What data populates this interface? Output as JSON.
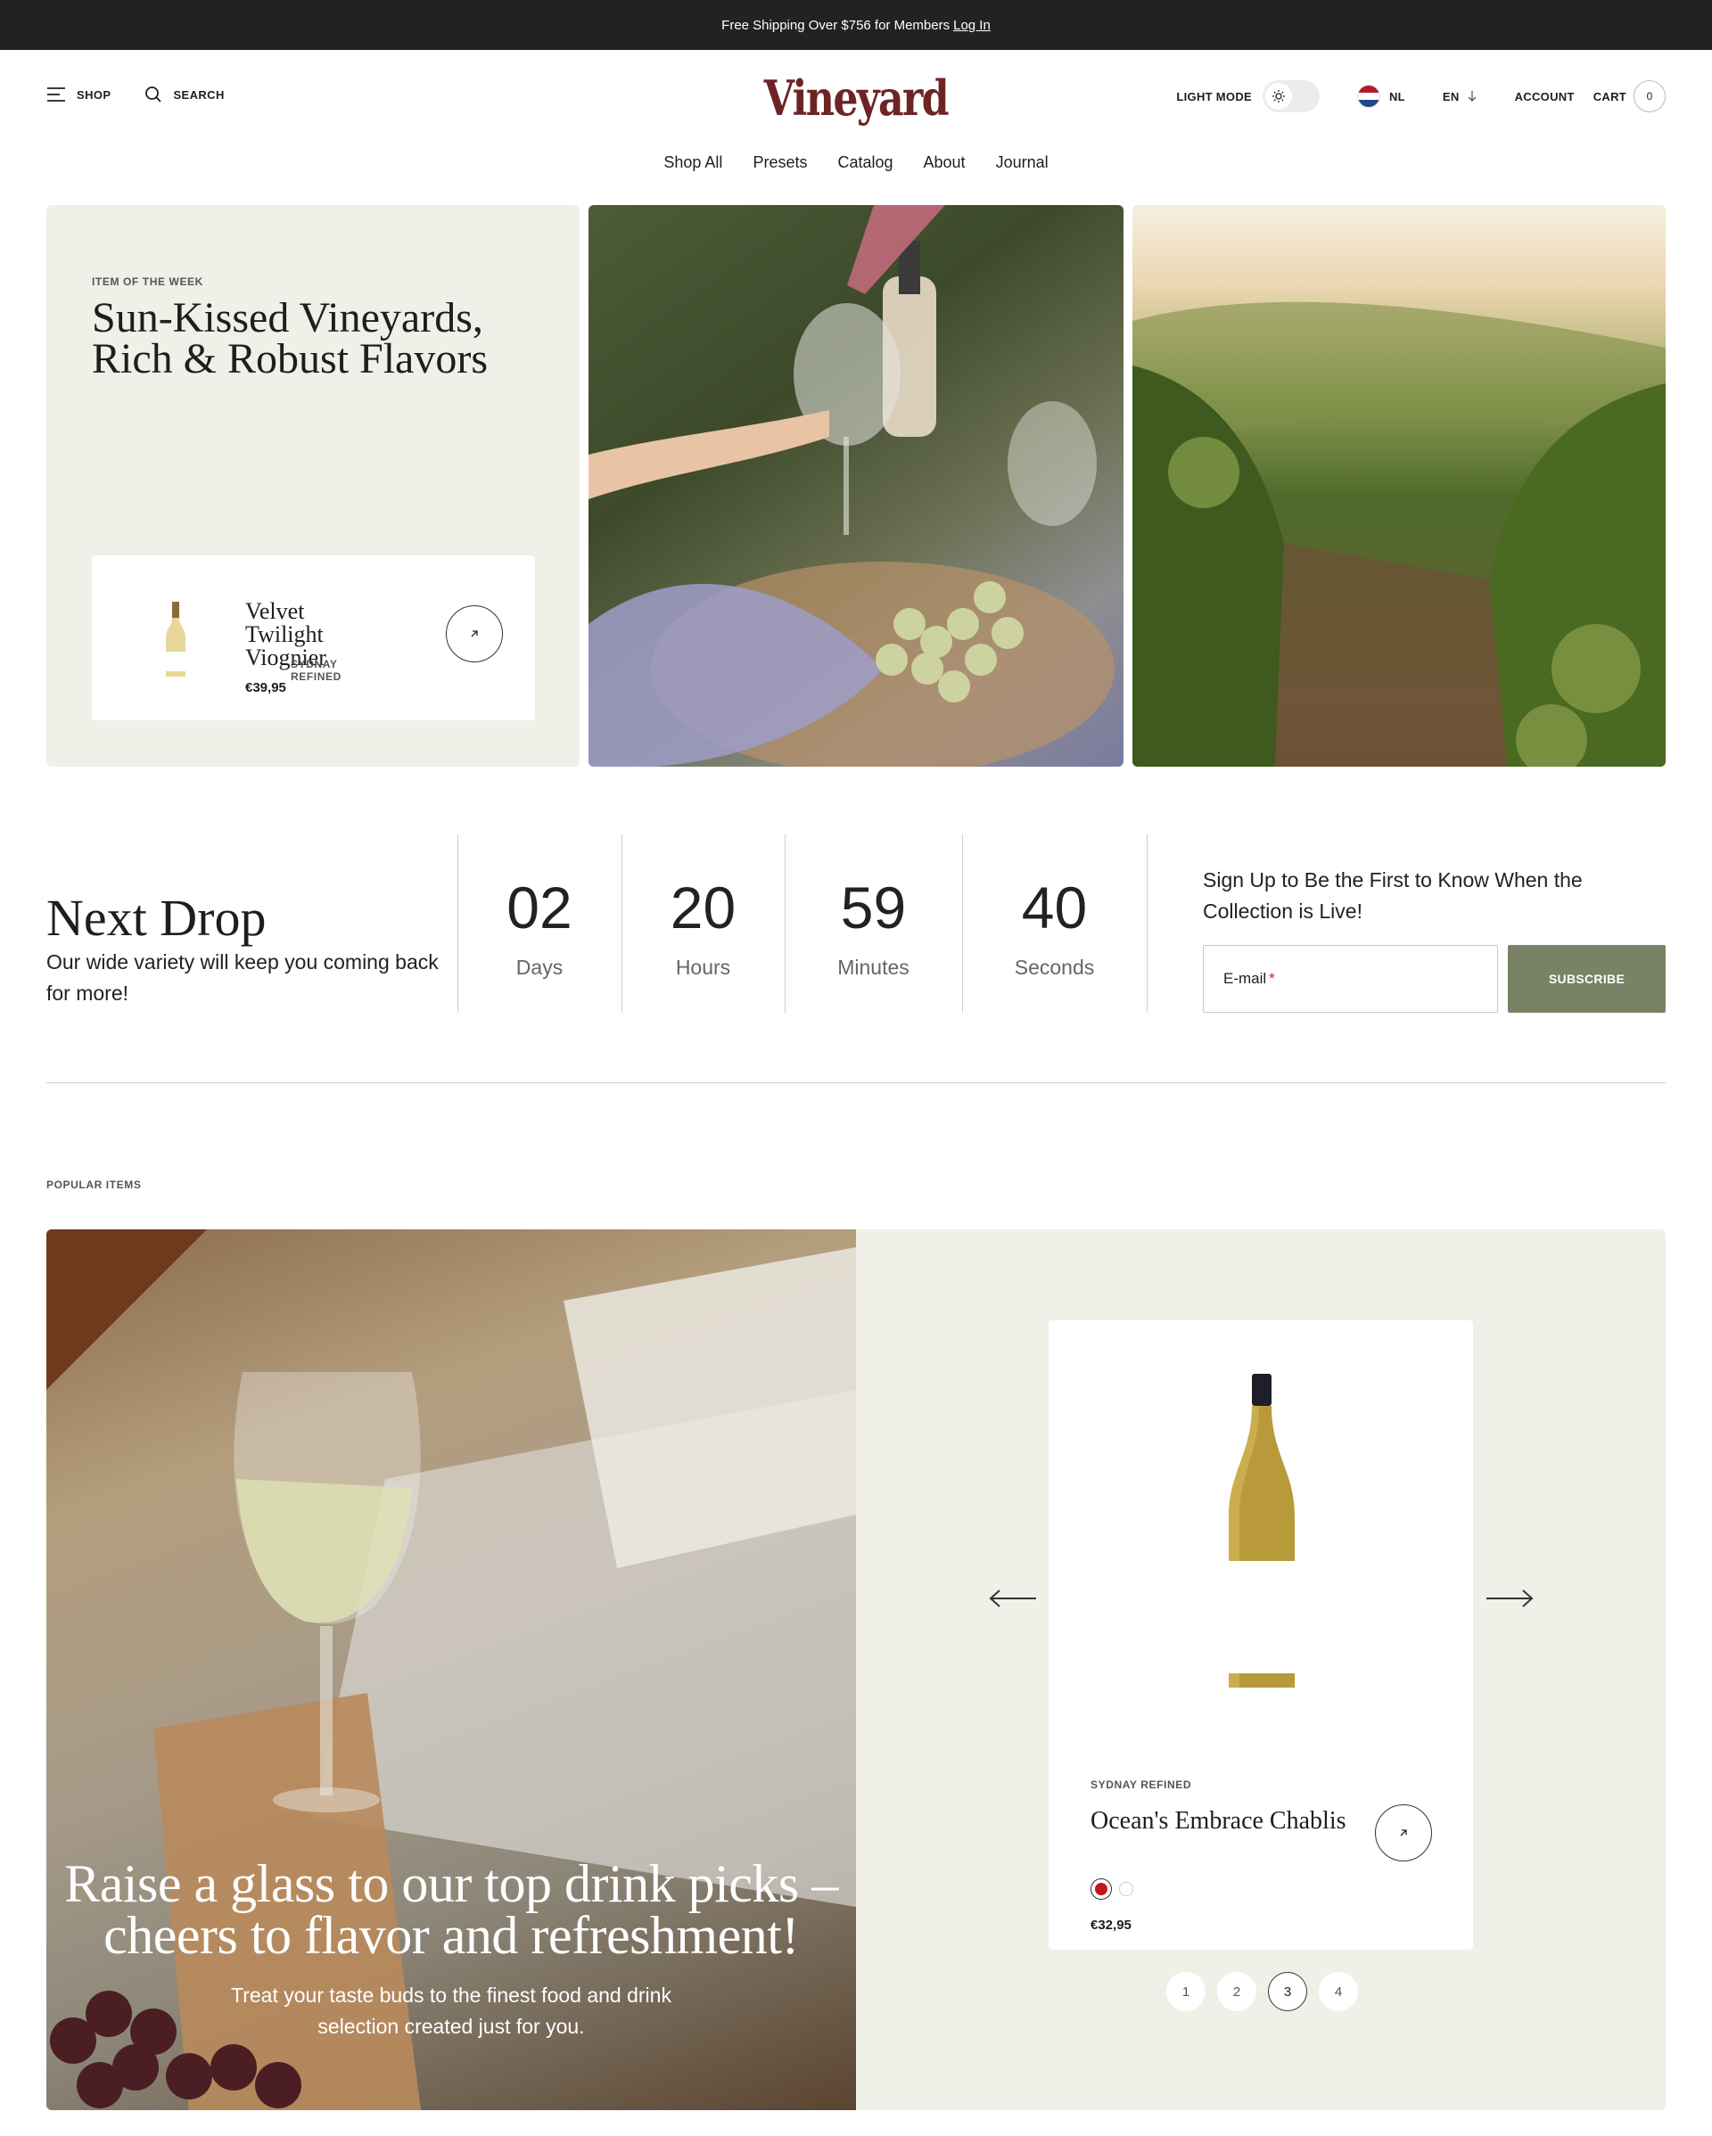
{
  "announcement": {
    "text": "Free Shipping Over $756 for Members",
    "link": "Log In"
  },
  "header": {
    "shop": "SHOP",
    "search": "SEARCH",
    "logo": "Vineyard",
    "light_mode": "LIGHT MODE",
    "country": "NL",
    "language": "EN",
    "account": "ACCOUNT",
    "cart": "CART",
    "cart_count": "0"
  },
  "nav": [
    "Shop All",
    "Presets",
    "Catalog",
    "About",
    "Journal"
  ],
  "hero": {
    "eyebrow": "ITEM OF THE WEEK",
    "title": "Sun-Kissed Vineyards, Rich & Robust Flavors",
    "product": {
      "vendor": "SYDNAY REFINED",
      "name": "Velvet Twilight Viognier",
      "price": "€39,95"
    }
  },
  "countdown": {
    "title": "Next Drop",
    "subtitle": "Our wide variety will keep you coming back for more!",
    "units": [
      {
        "value": "02",
        "label": "Days"
      },
      {
        "value": "20",
        "label": "Hours"
      },
      {
        "value": "59",
        "label": "Minutes"
      },
      {
        "value": "40",
        "label": "Seconds"
      }
    ],
    "signup_text": "Sign Up to Be the First to Know When the Collection is Live!",
    "email_label": "E-mail",
    "email_required": "*",
    "subscribe": "SUBSCRIBE"
  },
  "popular": {
    "eyebrow": "POPULAR ITEMS",
    "promo_title": "Raise a glass to our top drink picks – cheers to flavor and refreshment!",
    "promo_sub_line1": "Treat your taste buds to the finest food and drink",
    "promo_sub_line2": "selection created just for you.",
    "product": {
      "vendor": "SYDNAY REFINED",
      "name": "Ocean's Embrace Chablis",
      "price": "€32,95"
    },
    "pages": [
      "1",
      "2",
      "3",
      "4"
    ],
    "active_page": "3"
  },
  "colors": {
    "brand": "#6e2424",
    "subscribe": "#7a8266",
    "panel": "#f0efe8",
    "topbar": "#222222",
    "swatch_red": "#c3161b"
  },
  "icons": {
    "menu": "menu-icon",
    "search": "search-icon",
    "theme": "sun-icon",
    "flag": "netherlands-flag-icon",
    "chevron": "arrow-down-icon",
    "product_link": "arrow-up-right-icon",
    "prev": "arrow-left-icon",
    "next": "arrow-right-icon"
  }
}
